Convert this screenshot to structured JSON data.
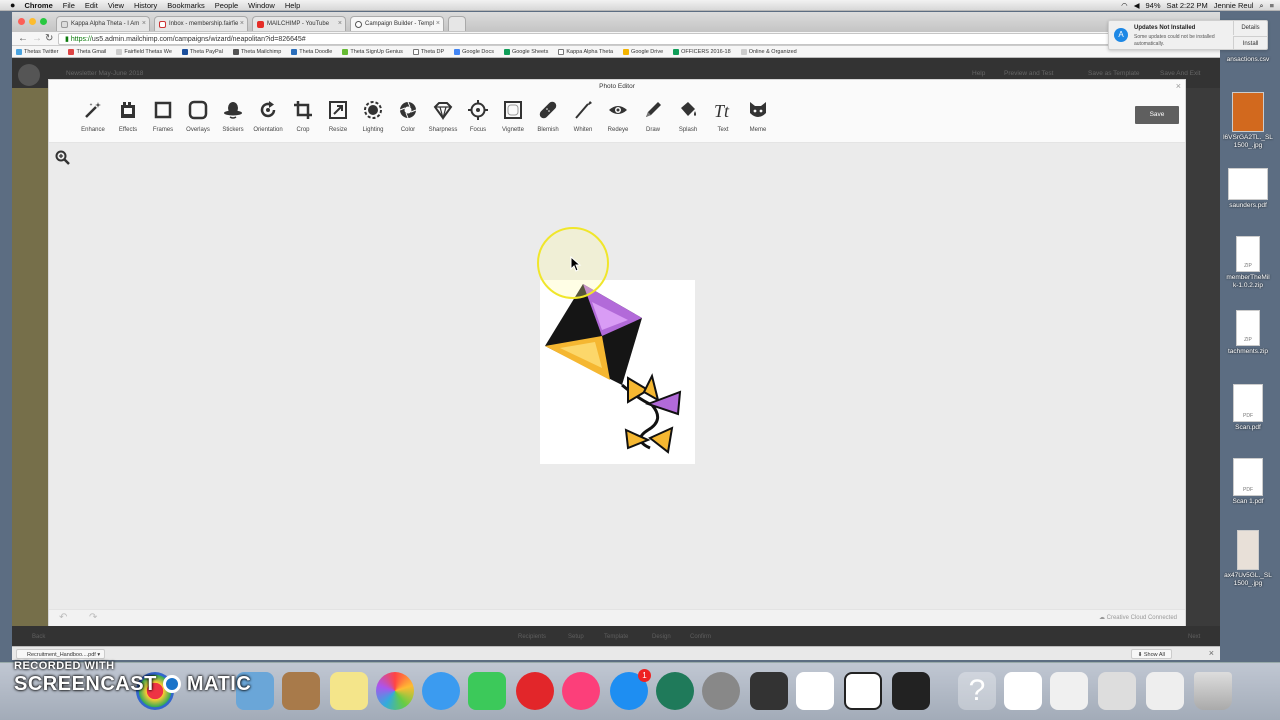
{
  "menubar": {
    "app": "Chrome",
    "items": [
      "File",
      "Edit",
      "View",
      "History",
      "Bookmarks",
      "People",
      "Window",
      "Help"
    ],
    "status": {
      "battery": "94%",
      "time": "Sat 2:22 PM",
      "user": "Jennie Reul"
    }
  },
  "tabs": [
    {
      "label": "Kappa Alpha Theta - I Am",
      "active": false
    },
    {
      "label": "Inbox - membership.fairfie",
      "active": false
    },
    {
      "label": "MAILCHIMP - YouTube",
      "active": false
    },
    {
      "label": "Campaign Builder - Templ",
      "active": true
    }
  ],
  "address": {
    "https": "https://",
    "rest": "us5.admin.mailchimp.com/campaigns/wizard/neapolitan?id=826645#"
  },
  "bookmarks": [
    "Thetas Twitter",
    "Theta Gmail",
    "Fairfield Thetas We",
    "Theta PayPal",
    "Theta Mailchimp",
    "Theta Doodle",
    "Theta SignUp Genius",
    "Theta DP",
    "Google Docs",
    "Google Sheets",
    "Kappa Alpha Theta",
    "Google Drive",
    "OFFICERS 2016-18",
    "Online & Organized"
  ],
  "mailchimp": {
    "campaign_name": "Newsletter May-June 2018",
    "header_links": [
      "Help",
      "Preview and Test",
      "Save as Template",
      "Save And Exit"
    ],
    "back": "Back",
    "next": "Next",
    "steps": [
      "Recipients",
      "Setup",
      "Template",
      "Design",
      "Confirm"
    ]
  },
  "photo_editor": {
    "title": "Photo Editor",
    "save_label": "Save",
    "tools": [
      {
        "label": "Enhance",
        "icon": "magic-wand-icon"
      },
      {
        "label": "Effects",
        "icon": "film-icon"
      },
      {
        "label": "Frames",
        "icon": "square-frame-icon"
      },
      {
        "label": "Overlays",
        "icon": "overlay-icon"
      },
      {
        "label": "Stickers",
        "icon": "hat-icon"
      },
      {
        "label": "Orientation",
        "icon": "rotate-icon"
      },
      {
        "label": "Crop",
        "icon": "crop-icon"
      },
      {
        "label": "Resize",
        "icon": "resize-icon"
      },
      {
        "label": "Lighting",
        "icon": "sun-icon"
      },
      {
        "label": "Color",
        "icon": "aperture-icon"
      },
      {
        "label": "Sharpness",
        "icon": "diamond-icon"
      },
      {
        "label": "Focus",
        "icon": "target-icon"
      },
      {
        "label": "Vignette",
        "icon": "vignette-icon"
      },
      {
        "label": "Blemish",
        "icon": "bandage-icon"
      },
      {
        "label": "Whiten",
        "icon": "brush-icon"
      },
      {
        "label": "Redeye",
        "icon": "eye-icon"
      },
      {
        "label": "Draw",
        "icon": "pencil-icon"
      },
      {
        "label": "Splash",
        "icon": "paint-bucket-icon"
      },
      {
        "label": "Text",
        "icon": "text-icon"
      },
      {
        "label": "Meme",
        "icon": "cat-icon"
      }
    ],
    "footer_status": "Creative Cloud Connected"
  },
  "notification": {
    "title": "Updates Not Installed",
    "body": "Some updates could not be installed automatically.",
    "details": "Details",
    "install": "Install"
  },
  "desktop_files": [
    {
      "name": "ansactions.csv",
      "kind": "csv"
    },
    {
      "name": "l6VSrGA2TL._SL\n1500_.jpg",
      "kind": "img"
    },
    {
      "name": "saunders.pdf",
      "kind": "doc"
    },
    {
      "name": "memberTheMil\nk-1.0.2.zip",
      "kind": "ZIP"
    },
    {
      "name": "tachments.zip",
      "kind": "ZIP"
    },
    {
      "name": "Scan.pdf",
      "kind": "PDF"
    },
    {
      "name": "Scan 1.pdf",
      "kind": "PDF"
    },
    {
      "name": "ax47Uv5GL._SL\n1500_.jpg",
      "kind": "img"
    }
  ],
  "downloads": {
    "file": "Recruitment_Handboo....pdf",
    "show_all": "Show All"
  },
  "watermark": {
    "line1": "RECORDED WITH",
    "line2": "SCREENCAST",
    "line3": "MATIC"
  },
  "dock_badge": "1",
  "colors": {
    "accent": "#1e88e5",
    "editor_bg": "#ebebeb",
    "save": "#5f5f5f"
  }
}
